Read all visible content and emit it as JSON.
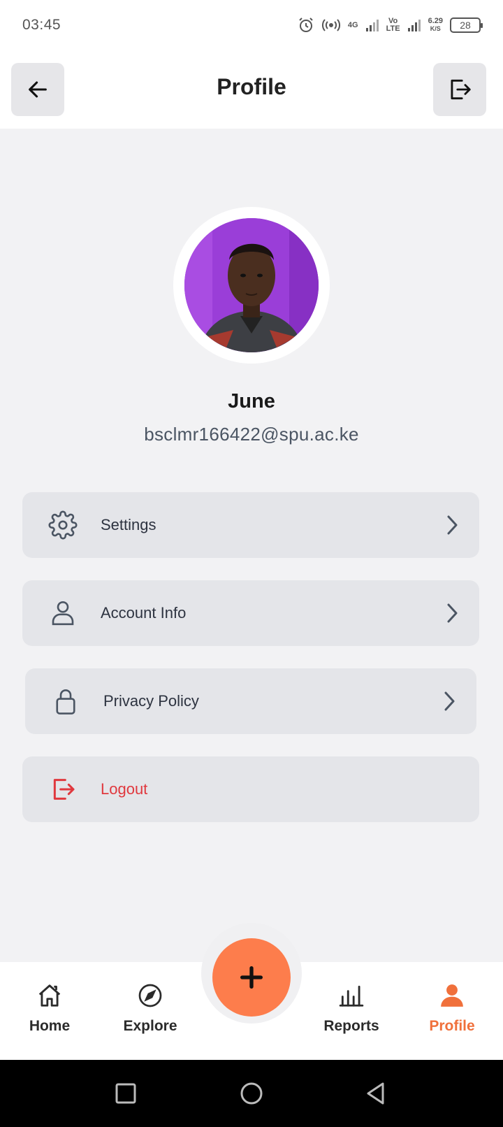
{
  "status_bar": {
    "time": "03:45",
    "network_4g": "4G",
    "volte_top": "Vo",
    "volte_bottom": "LTE",
    "speed_value": "6.29",
    "speed_unit": "K/S",
    "battery": "28"
  },
  "header": {
    "title": "Profile",
    "back_icon": "arrow-left-icon",
    "exit_icon": "logout-icon"
  },
  "profile": {
    "name": "June",
    "email": "bsclmr166422@spu.ac.ke"
  },
  "menu": {
    "settings_label": "Settings",
    "account_label": "Account Info",
    "privacy_label": "Privacy Policy",
    "logout_label": "Logout"
  },
  "bottom_nav": {
    "home": "Home",
    "explore": "Explore",
    "reports": "Reports",
    "profile": "Profile",
    "active": "Profile"
  },
  "colors": {
    "accent": "#fd7d4c",
    "active_tab": "#f0703b",
    "logout": "#e0383e",
    "menu_bg": "#e4e5e9",
    "page_bg": "#f2f2f4"
  }
}
